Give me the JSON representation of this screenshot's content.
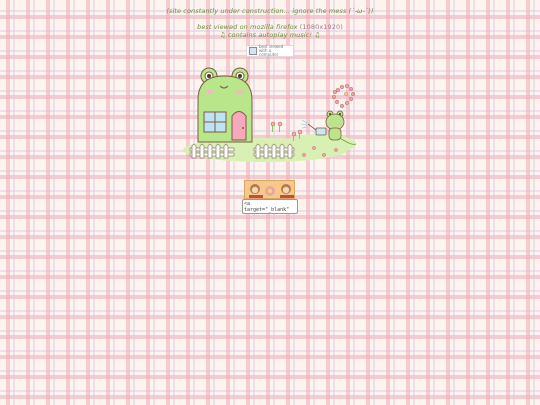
{
  "header": {
    "notice": "(site constantly under construction... ignore the mess (´-ω-`))",
    "viewed_prefix": "best viewed on mozilla firefox ",
    "viewed_resolution": "(1080x1920)",
    "autoplay": "♫ contains autoplay music! ♫"
  },
  "badge": {
    "icon": "computer-icon",
    "text": "best viewed with a computer"
  },
  "scene": {
    "house_icon": "frog-house-icon",
    "frog_icon": "frog-watering-icon",
    "fence_icon": "fence-icon",
    "flowers_icon": "flower-icon",
    "colors": {
      "frog_green": "#b9e68a",
      "door_pink": "#f6a9bd",
      "window_blue": "#bfe3f3",
      "outline": "#7b5b43"
    }
  },
  "stamp": {
    "icon": "monkeys-stamp-icon"
  },
  "code_box": {
    "text": "<a\ntarget=\"_blank\""
  }
}
